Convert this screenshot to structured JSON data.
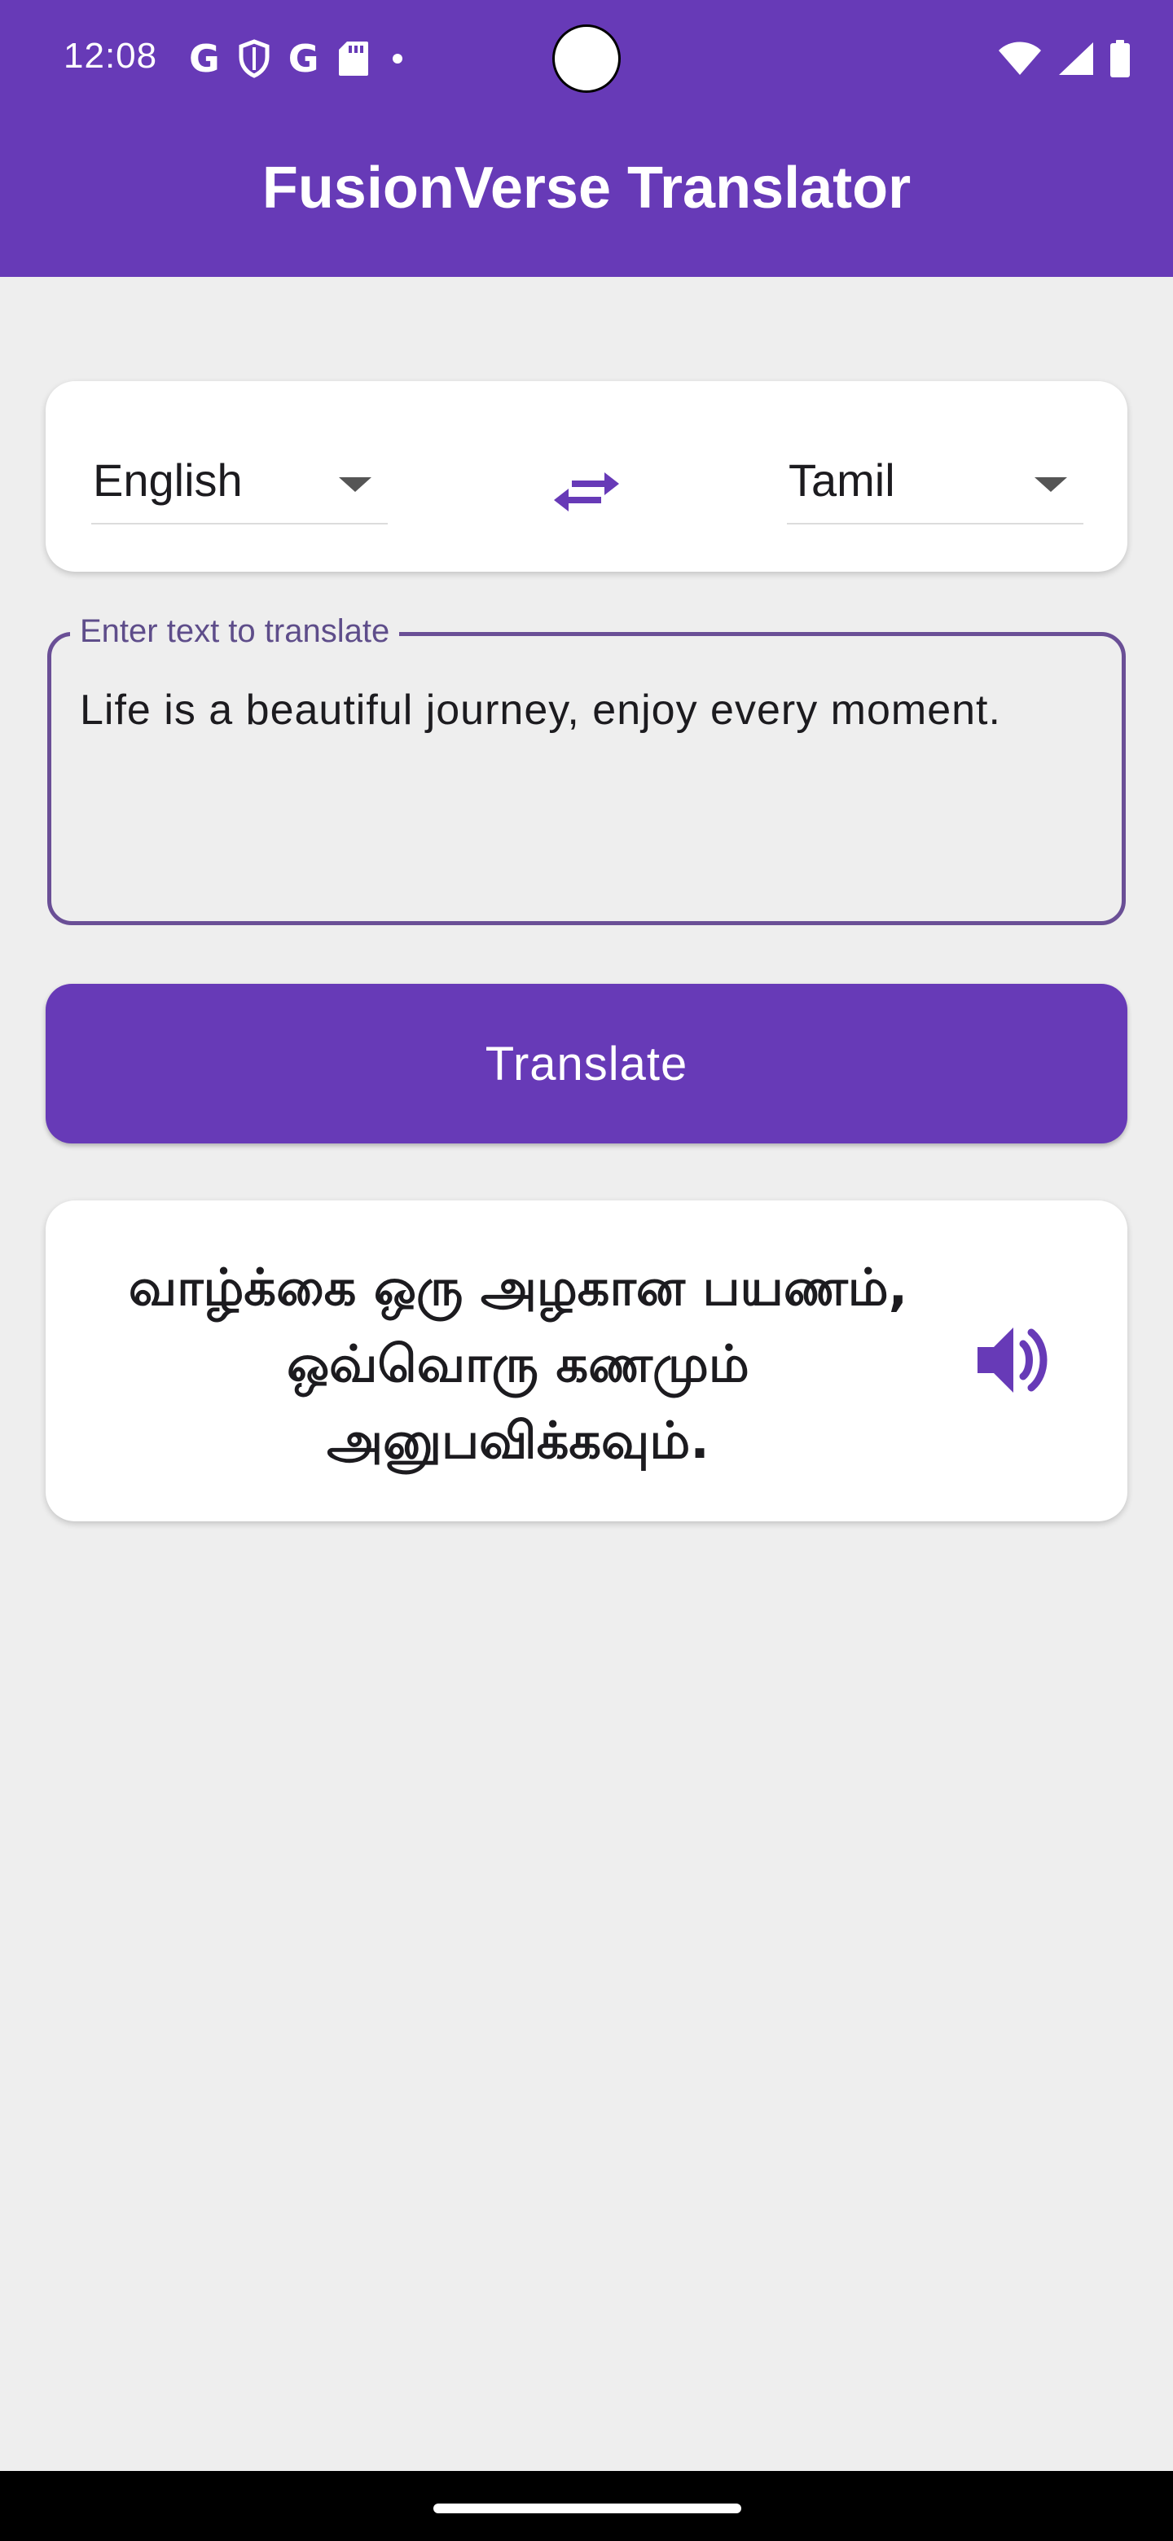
{
  "status_bar": {
    "time": "12:08",
    "left_icons": [
      "google-g-icon",
      "shield-icon",
      "google-g-icon",
      "sd-card-icon",
      "dot-icon"
    ],
    "right_icons": [
      "wifi-icon",
      "signal-icon",
      "battery-icon"
    ],
    "g_letter": "G"
  },
  "app_bar": {
    "title": "FusionVerse Translator",
    "color": "#673ab7"
  },
  "language_selector": {
    "from_language": "English",
    "to_language": "Tamil",
    "swap_icon": "swap-horizontal-icon"
  },
  "input": {
    "label": "Enter text to translate",
    "value": "Life is a beautiful journey, enjoy every moment."
  },
  "translate_button": {
    "label": "Translate"
  },
  "result": {
    "text": "வாழ்க்கை ஒரு அழகான பயணம், ஒவ்வொரு கணமும் அனுபவிக்கவும்.",
    "speaker_icon": "volume-up-icon"
  },
  "colors": {
    "primary": "#673ab7",
    "background": "#eeeeee",
    "card": "#ffffff",
    "outline": "#6a4f96"
  }
}
